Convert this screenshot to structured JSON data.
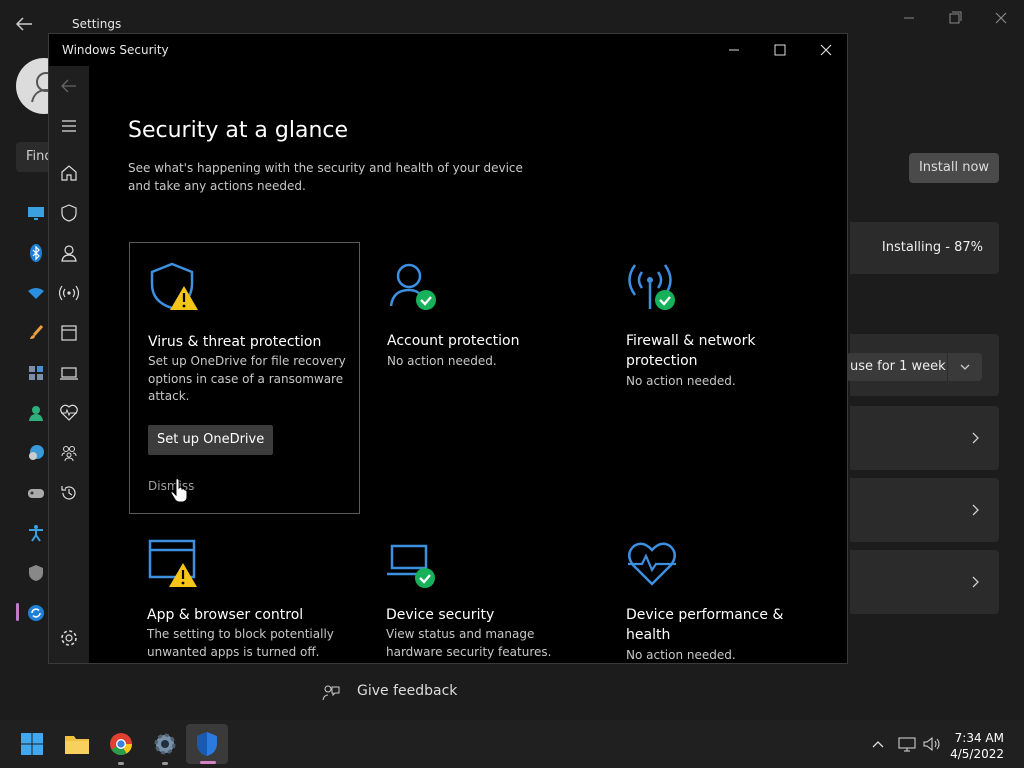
{
  "settings": {
    "title": "Settings",
    "search_text": "Find",
    "install_now": "Install now",
    "installing": "Installing - 87%",
    "pause": "use for 1 week",
    "give_feedback": "Give feedback"
  },
  "security": {
    "window_title": "Windows Security",
    "heading": "Security at a glance",
    "intro": "See what's happening with the security and health of your device and take any actions needed.",
    "cards": [
      {
        "title": "Virus & threat protection",
        "desc": "Set up OneDrive for file recovery options in case of a ransomware attack.",
        "button": "Set up OneDrive",
        "dismiss": "Dismiss",
        "status": "warning",
        "icon": "shield-icon"
      },
      {
        "title": "Account protection",
        "desc": "No action needed.",
        "status": "ok",
        "icon": "person-icon"
      },
      {
        "title": "Firewall & network protection",
        "desc": "No action needed.",
        "status": "ok",
        "icon": "antenna-icon"
      },
      {
        "title": "App & browser control",
        "desc": "The setting to block potentially unwanted apps is turned off.",
        "status": "warning",
        "icon": "browser-window-icon"
      },
      {
        "title": "Device security",
        "desc": "View status and manage hardware security features.",
        "status": "ok",
        "icon": "laptop-icon"
      },
      {
        "title": "Device performance & health",
        "desc": "No action needed.",
        "status": "ok",
        "icon": "heart-pulse-icon"
      }
    ]
  },
  "taskbar": {
    "time": "7:34 AM",
    "date": "4/5/2022"
  },
  "colors": {
    "accent_blue": "#3d8fe0",
    "warning_yellow": "#f5c518",
    "ok_green": "#16b15a"
  }
}
